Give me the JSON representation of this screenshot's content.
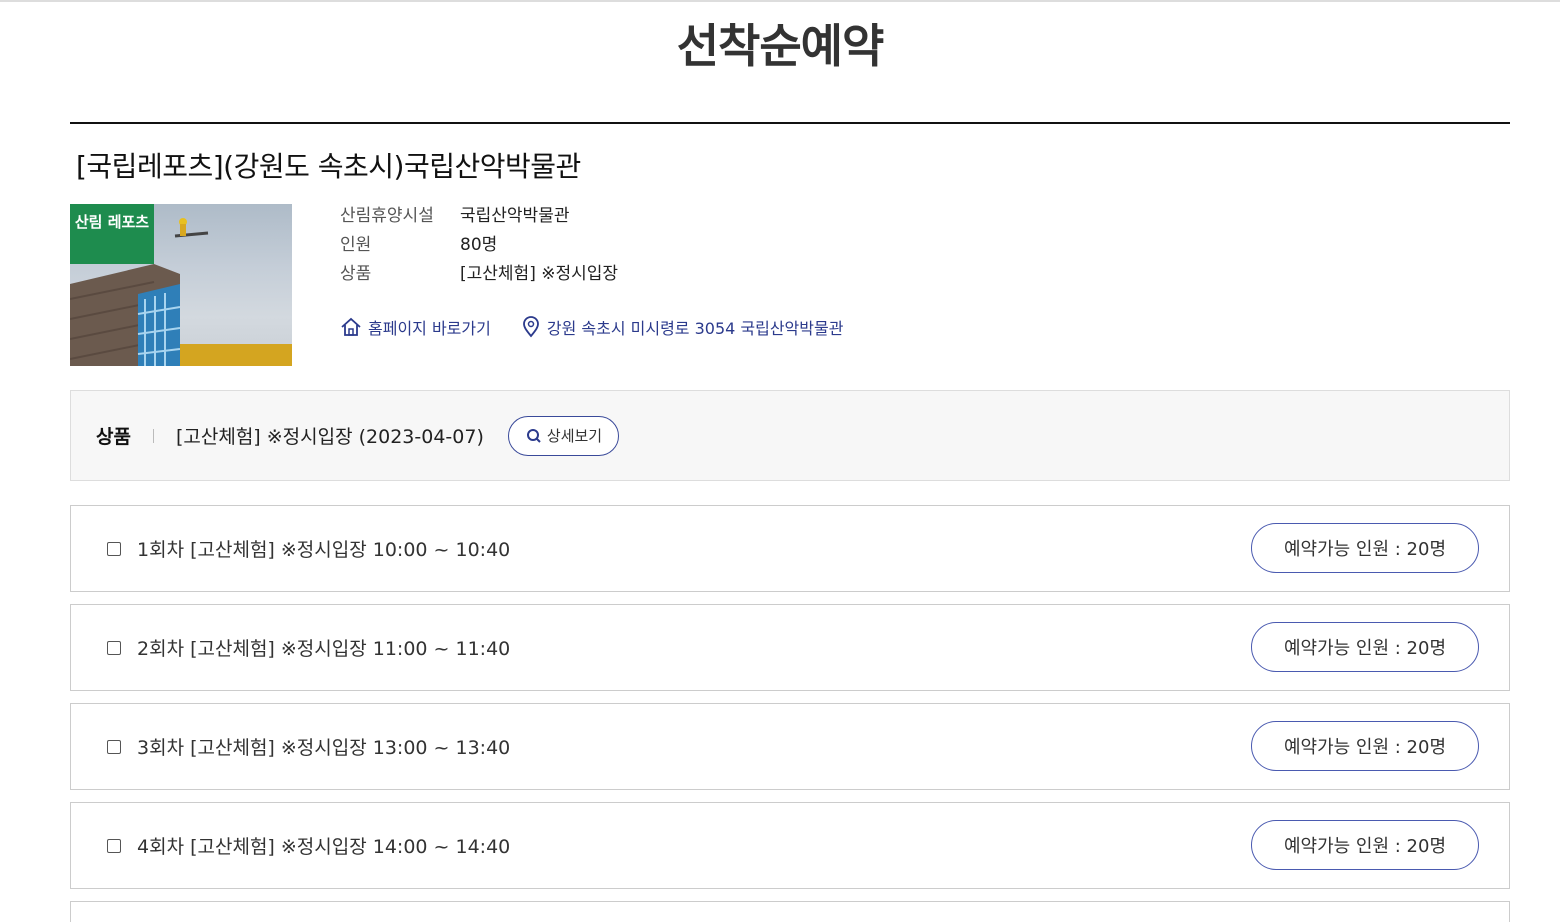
{
  "page_title": "선착순예약",
  "facility": {
    "title": "[국립레포츠](강원도 속초시)국립산악박물관",
    "badge": "산림 레포츠",
    "info": [
      {
        "label": "산림휴양시설",
        "value": "국립산악박물관"
      },
      {
        "label": "인원",
        "value": "80명"
      },
      {
        "label": "상품",
        "value": "[고산체험] ※정시입장"
      }
    ],
    "homepage_link": "홈페이지 바로가기",
    "address": "강원 속초시 미시령로 3054 국립산악박물관"
  },
  "product": {
    "label": "상품",
    "value": "[고산체험] ※정시입장 (2023-04-07)",
    "detail_button": "상세보기"
  },
  "sessions": [
    {
      "label": "1회차 [고산체험] ※정시입장 10:00 ~ 10:40",
      "availability": "예약가능 인원 : 20명"
    },
    {
      "label": "2회차 [고산체험] ※정시입장 11:00 ~ 11:40",
      "availability": "예약가능 인원 : 20명"
    },
    {
      "label": "3회차 [고산체험] ※정시입장 13:00 ~ 13:40",
      "availability": "예약가능 인원 : 20명"
    },
    {
      "label": "4회차 [고산체험] ※정시입장 14:00 ~ 14:40",
      "availability": "예약가능 인원 : 20명"
    }
  ],
  "colors": {
    "badge_green": "#1e8c4e",
    "link_blue": "#2b3a8c",
    "pill_border": "#4a5ab0"
  },
  "icons": [
    "home-icon",
    "location-pin-icon",
    "search-icon"
  ]
}
